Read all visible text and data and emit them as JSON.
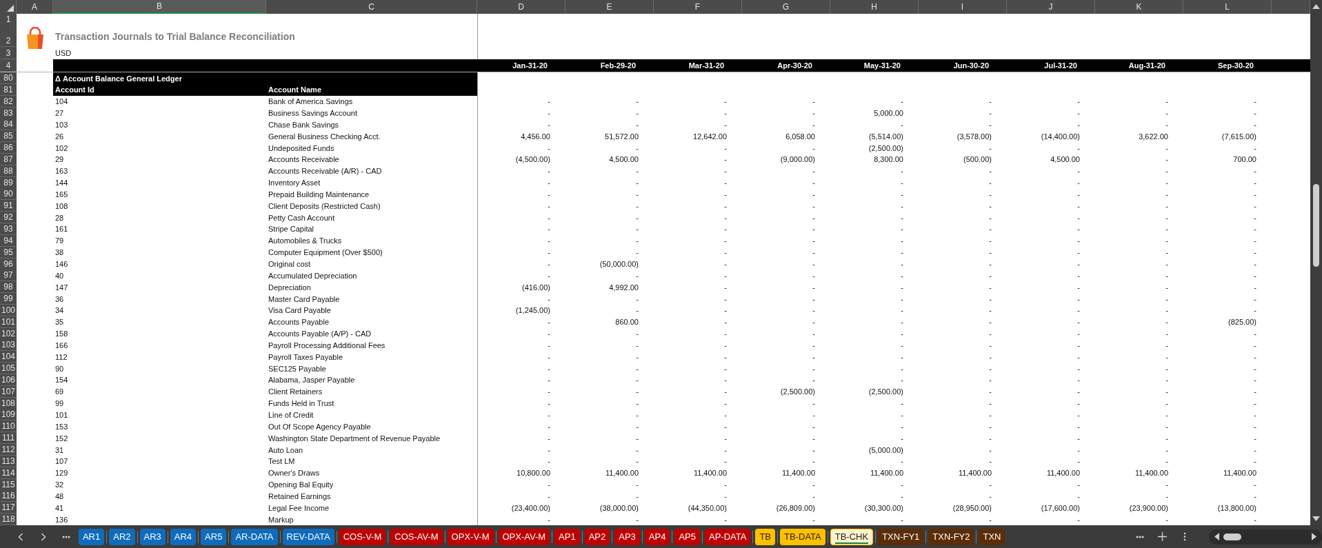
{
  "column_headers": [
    {
      "label": "A",
      "selected": false
    },
    {
      "label": "B",
      "selected": true
    },
    {
      "label": "C",
      "selected": false
    },
    {
      "label": "D",
      "selected": false
    },
    {
      "label": "E",
      "selected": false
    },
    {
      "label": "F",
      "selected": false
    },
    {
      "label": "G",
      "selected": false
    },
    {
      "label": "H",
      "selected": false
    },
    {
      "label": "I",
      "selected": false
    },
    {
      "label": "J",
      "selected": false
    },
    {
      "label": "K",
      "selected": false
    },
    {
      "label": "L",
      "selected": false
    }
  ],
  "header_row_numbers": [
    "1",
    "2",
    "3",
    "4",
    "80",
    "81"
  ],
  "title": "Transaction Journals to Trial Balance Reconciliation",
  "currency": "USD",
  "periods": [
    "Jan-31-20",
    "Feb-29-20",
    "Mar-31-20",
    "Apr-30-20",
    "May-31-20",
    "Jun-30-20",
    "Jul-31-20",
    "Aug-31-20",
    "Sep-30-20"
  ],
  "section_title": "Δ Account Balance General Ledger",
  "table": {
    "columns": [
      "Account Id",
      "Account Name"
    ],
    "rows": [
      {
        "row_number": "82",
        "account_id": "104",
        "account_name": "Bank of America Savings",
        "values": [
          "-",
          "-",
          "-",
          "-",
          "-",
          "-",
          "-",
          "-",
          "-"
        ]
      },
      {
        "row_number": "83",
        "account_id": "27",
        "account_name": "Business Savings Account",
        "values": [
          "-",
          "-",
          "-",
          "-",
          "5,000.00",
          "-",
          "-",
          "-",
          "-"
        ]
      },
      {
        "row_number": "84",
        "account_id": "103",
        "account_name": "Chase Bank Savings",
        "values": [
          "-",
          "-",
          "-",
          "-",
          "-",
          "-",
          "-",
          "-",
          "-"
        ]
      },
      {
        "row_number": "85",
        "account_id": "26",
        "account_name": "General Business Checking Acct.",
        "values": [
          "4,456.00",
          "51,572.00",
          "12,642.00",
          "6,058.00",
          "(5,514.00)",
          "(3,578.00)",
          "(14,400.00)",
          "3,622.00",
          "(7,615.00)"
        ]
      },
      {
        "row_number": "86",
        "account_id": "102",
        "account_name": "Undeposited Funds",
        "values": [
          "-",
          "-",
          "-",
          "-",
          "(2,500.00)",
          "-",
          "-",
          "-",
          "-"
        ]
      },
      {
        "row_number": "87",
        "account_id": "29",
        "account_name": "Accounts Receivable",
        "values": [
          "(4,500.00)",
          "4,500.00",
          "-",
          "(9,000.00)",
          "8,300.00",
          "(500.00)",
          "4,500.00",
          "-",
          "700.00"
        ]
      },
      {
        "row_number": "88",
        "account_id": "163",
        "account_name": "Accounts Receivable (A/R) - CAD",
        "values": [
          "-",
          "-",
          "-",
          "-",
          "-",
          "-",
          "-",
          "-",
          "-"
        ]
      },
      {
        "row_number": "89",
        "account_id": "144",
        "account_name": "Inventory Asset",
        "values": [
          "-",
          "-",
          "-",
          "-",
          "-",
          "-",
          "-",
          "-",
          "-"
        ]
      },
      {
        "row_number": "90",
        "account_id": "165",
        "account_name": "Prepaid Building Maintenance",
        "values": [
          "-",
          "-",
          "-",
          "-",
          "-",
          "-",
          "-",
          "-",
          "-"
        ]
      },
      {
        "row_number": "91",
        "account_id": "108",
        "account_name": "Client Deposits (Restricted Cash)",
        "values": [
          "-",
          "-",
          "-",
          "-",
          "-",
          "-",
          "-",
          "-",
          "-"
        ]
      },
      {
        "row_number": "92",
        "account_id": "28",
        "account_name": "Petty Cash Account",
        "values": [
          "-",
          "-",
          "-",
          "-",
          "-",
          "-",
          "-",
          "-",
          "-"
        ]
      },
      {
        "row_number": "93",
        "account_id": "161",
        "account_name": "Stripe Capital",
        "values": [
          "-",
          "-",
          "-",
          "-",
          "-",
          "-",
          "-",
          "-",
          "-"
        ]
      },
      {
        "row_number": "94",
        "account_id": "79",
        "account_name": "Automobiles & Trucks",
        "values": [
          "-",
          "-",
          "-",
          "-",
          "-",
          "-",
          "-",
          "-",
          "-"
        ]
      },
      {
        "row_number": "95",
        "account_id": "38",
        "account_name": "Computer Equipment (Over $500)",
        "values": [
          "-",
          "-",
          "-",
          "-",
          "-",
          "-",
          "-",
          "-",
          "-"
        ]
      },
      {
        "row_number": "96",
        "account_id": "146",
        "account_name": "Original cost",
        "values": [
          "-",
          "(50,000.00)",
          "-",
          "-",
          "-",
          "-",
          "-",
          "-",
          "-"
        ]
      },
      {
        "row_number": "97",
        "account_id": "40",
        "account_name": "Accumulated Depreciation",
        "values": [
          "-",
          "-",
          "-",
          "-",
          "-",
          "-",
          "-",
          "-",
          "-"
        ]
      },
      {
        "row_number": "98",
        "account_id": "147",
        "account_name": "Depreciation",
        "values": [
          "(416.00)",
          "4,992.00",
          "-",
          "-",
          "-",
          "-",
          "-",
          "-",
          "-"
        ]
      },
      {
        "row_number": "99",
        "account_id": "36",
        "account_name": "Master Card Payable",
        "values": [
          "-",
          "-",
          "-",
          "-",
          "-",
          "-",
          "-",
          "-",
          "-"
        ]
      },
      {
        "row_number": "100",
        "account_id": "34",
        "account_name": "Visa Card Payable",
        "values": [
          "(1,245.00)",
          "-",
          "-",
          "-",
          "-",
          "-",
          "-",
          "-",
          "-"
        ]
      },
      {
        "row_number": "101",
        "account_id": "35",
        "account_name": "Accounts Payable",
        "values": [
          "-",
          "860.00",
          "-",
          "-",
          "-",
          "-",
          "-",
          "-",
          "(825.00)"
        ]
      },
      {
        "row_number": "102",
        "account_id": "158",
        "account_name": "Accounts Payable (A/P) - CAD",
        "values": [
          "-",
          "-",
          "-",
          "-",
          "-",
          "-",
          "-",
          "-",
          "-"
        ]
      },
      {
        "row_number": "103",
        "account_id": "166",
        "account_name": "Payroll Processing Additional Fees",
        "values": [
          "-",
          "-",
          "-",
          "-",
          "-",
          "-",
          "-",
          "-",
          "-"
        ]
      },
      {
        "row_number": "104",
        "account_id": "112",
        "account_name": "Payroll Taxes Payable",
        "values": [
          "-",
          "-",
          "-",
          "-",
          "-",
          "-",
          "-",
          "-",
          "-"
        ]
      },
      {
        "row_number": "105",
        "account_id": "90",
        "account_name": "SEC125 Payable",
        "values": [
          "-",
          "-",
          "-",
          "-",
          "-",
          "-",
          "-",
          "-",
          "-"
        ]
      },
      {
        "row_number": "106",
        "account_id": "154",
        "account_name": "Alabama, Jasper Payable",
        "values": [
          "-",
          "-",
          "-",
          "-",
          "-",
          "-",
          "-",
          "-",
          "-"
        ]
      },
      {
        "row_number": "107",
        "account_id": "69",
        "account_name": "Client Retainers",
        "values": [
          "-",
          "-",
          "-",
          "(2,500.00)",
          "(2,500.00)",
          "-",
          "-",
          "-",
          "-"
        ]
      },
      {
        "row_number": "108",
        "account_id": "99",
        "account_name": "Funds Held in Trust",
        "values": [
          "-",
          "-",
          "-",
          "-",
          "-",
          "-",
          "-",
          "-",
          "-"
        ]
      },
      {
        "row_number": "109",
        "account_id": "101",
        "account_name": "Line of Credit",
        "values": [
          "-",
          "-",
          "-",
          "-",
          "-",
          "-",
          "-",
          "-",
          "-"
        ]
      },
      {
        "row_number": "110",
        "account_id": "153",
        "account_name": "Out Of Scope Agency Payable",
        "values": [
          "-",
          "-",
          "-",
          "-",
          "-",
          "-",
          "-",
          "-",
          "-"
        ]
      },
      {
        "row_number": "111",
        "account_id": "152",
        "account_name": "Washington State Department of Revenue Payable",
        "values": [
          "-",
          "-",
          "-",
          "-",
          "-",
          "-",
          "-",
          "-",
          "-"
        ]
      },
      {
        "row_number": "112",
        "account_id": "31",
        "account_name": "Auto Loan",
        "values": [
          "-",
          "-",
          "-",
          "-",
          "(5,000.00)",
          "-",
          "-",
          "-",
          "-"
        ]
      },
      {
        "row_number": "113",
        "account_id": "107",
        "account_name": "Test LM",
        "values": [
          "-",
          "-",
          "-",
          "-",
          "-",
          "-",
          "-",
          "-",
          "-"
        ]
      },
      {
        "row_number": "114",
        "account_id": "129",
        "account_name": "Owner's  Draws",
        "values": [
          "10,800.00",
          "11,400.00",
          "11,400.00",
          "11,400.00",
          "11,400.00",
          "11,400.00",
          "11,400.00",
          "11,400.00",
          "11,400.00"
        ]
      },
      {
        "row_number": "115",
        "account_id": "32",
        "account_name": "Opening Bal Equity",
        "values": [
          "-",
          "-",
          "-",
          "-",
          "-",
          "-",
          "-",
          "-",
          "-"
        ]
      },
      {
        "row_number": "116",
        "account_id": "48",
        "account_name": "Retained Earnings",
        "values": [
          "-",
          "-",
          "-",
          "-",
          "-",
          "-",
          "-",
          "-",
          "-"
        ]
      },
      {
        "row_number": "117",
        "account_id": "41",
        "account_name": "Legal Fee Income",
        "values": [
          "(23,400.00)",
          "(38,000.00)",
          "(44,350.00)",
          "(26,809.00)",
          "(30,300.00)",
          "(28,950.00)",
          "(17,600.00)",
          "(23,900.00)",
          "(13,800.00)"
        ]
      },
      {
        "row_number": "118",
        "account_id": "136",
        "account_name": "Markup",
        "values": [
          "-",
          "-",
          "-",
          "-",
          "-",
          "-",
          "-",
          "-",
          "-"
        ]
      }
    ]
  },
  "sheet_tabs": [
    {
      "label": "AR1",
      "color": "#0f6cbd",
      "selected": false
    },
    {
      "label": "AR2",
      "color": "#0f6cbd",
      "selected": false
    },
    {
      "label": "AR3",
      "color": "#0f6cbd",
      "selected": false
    },
    {
      "label": "AR4",
      "color": "#0f6cbd",
      "selected": false
    },
    {
      "label": "AR5",
      "color": "#0f6cbd",
      "selected": false
    },
    {
      "label": "AR-DATA",
      "color": "#0f6cbd",
      "selected": false
    },
    {
      "label": "REV-DATA",
      "color": "#0f6cbd",
      "selected": false
    },
    {
      "label": "COS-V-M",
      "color": "#c00000",
      "selected": false
    },
    {
      "label": "COS-AV-M",
      "color": "#c00000",
      "selected": false
    },
    {
      "label": "OPX-V-M",
      "color": "#c00000",
      "selected": false
    },
    {
      "label": "OPX-AV-M",
      "color": "#c00000",
      "selected": false
    },
    {
      "label": "AP1",
      "color": "#c00000",
      "selected": false
    },
    {
      "label": "AP2",
      "color": "#c00000",
      "selected": false
    },
    {
      "label": "AP3",
      "color": "#c00000",
      "selected": false
    },
    {
      "label": "AP4",
      "color": "#c00000",
      "selected": false
    },
    {
      "label": "AP5",
      "color": "#c00000",
      "selected": false
    },
    {
      "label": "AP-DATA",
      "color": "#c00000",
      "selected": false
    },
    {
      "label": "TB",
      "color": "#ffc000",
      "selected": false
    },
    {
      "label": "TB-DATA",
      "color": "#ffc000",
      "selected": false
    },
    {
      "label": "TB-CHK",
      "color": "#ffc000",
      "selected": true
    },
    {
      "label": "TXN-FY1",
      "color": "#5c2d06",
      "selected": false
    },
    {
      "label": "TXN-FY2",
      "color": "#5c2d06",
      "selected": false
    },
    {
      "label": "TXN",
      "color": "#5c2d06",
      "selected": false
    }
  ]
}
